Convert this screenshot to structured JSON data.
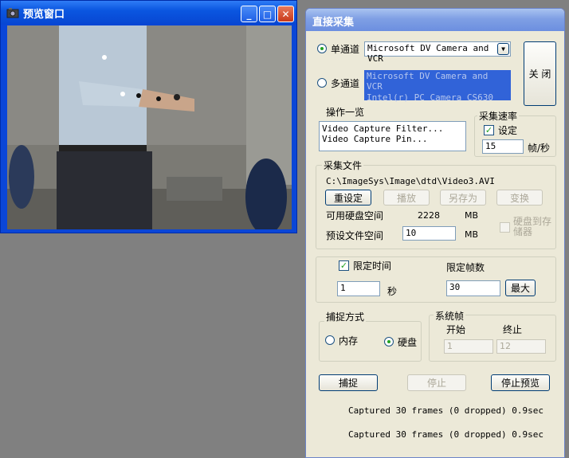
{
  "preview_window": {
    "title": "预览窗口",
    "minimize_glyph": "_",
    "maximize_glyph": "□",
    "close_glyph": "✕",
    "icon": "camera-icon"
  },
  "dialog": {
    "title": "直接采集",
    "single_channel_label": "单通道",
    "single_channel_selected": true,
    "device_select_value": "Microsoft DV Camera and VCR",
    "multi_channel_label": "多通道",
    "multi_channel_selected": false,
    "device_list": [
      "Microsoft DV Camera and VCR",
      "Intel(r) PC Camera CS630"
    ],
    "close_button": "关 闭",
    "operations_label": "操作一览",
    "operations_list": [
      "Video Capture Filter...",
      "Video Capture Pin..."
    ],
    "capture_rate_group": "采集速率",
    "set_label": "设定",
    "set_checked": true,
    "fps_value": "15",
    "fps_unit": "帧/秒",
    "capture_file_group": "采集文件",
    "file_path": "C:\\ImageSys\\Image\\dtd\\Video3.AVI",
    "reset_button": "重设定",
    "play_button": "播放",
    "save_as_button": "另存为",
    "convert_button": "变换",
    "free_space_label": "可用硬盘空间",
    "free_space_value": "2228",
    "free_space_unit": "MB",
    "disk_to_memory_label": "硬盘到存储器",
    "preset_size_label": "预设文件空间",
    "preset_size_value": "10",
    "preset_size_unit": "MB",
    "limit_time_label": "限定时间",
    "limit_time_checked": true,
    "limit_frames_label": "限定帧数",
    "time_value": "1",
    "time_unit": "秒",
    "frames_value": "30",
    "max_button": "最大",
    "capture_mode_group": "捕捉方式",
    "memory_label": "内存",
    "memory_selected": false,
    "disk_label": "硬盘",
    "disk_selected": true,
    "system_frame_group": "系统帧",
    "start_label": "开始",
    "end_label": "终止",
    "start_value": "1",
    "end_value": "12",
    "capture_button": "捕捉",
    "stop_button": "停止",
    "stop_preview_button": "停止预览",
    "status_line_1": "Captured 30 frames (0 dropped) 0.9sec",
    "status_line_2": "Captured 30 frames (0 dropped) 0.9sec"
  },
  "colors": {
    "xp_blue": "#0a46d8",
    "dialog_bg": "#ece9d8",
    "desktop": "#808080"
  }
}
